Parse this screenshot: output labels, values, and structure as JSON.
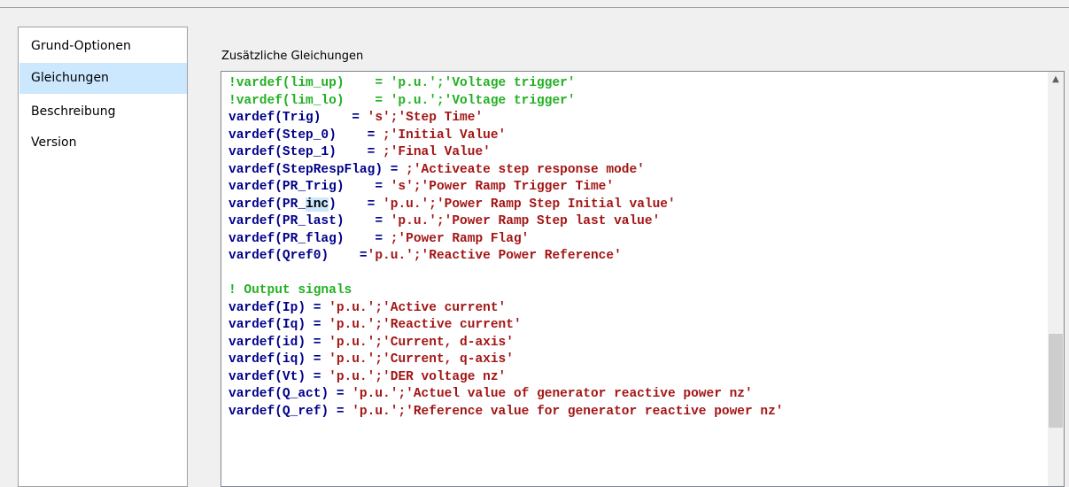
{
  "sidebar": {
    "items": [
      {
        "label": "Grund-Optionen"
      },
      {
        "label": "Gleichungen"
      },
      {
        "label": "Beschreibung"
      },
      {
        "label": "Version"
      }
    ],
    "selected": "Gleichungen"
  },
  "section_label": "Zusätzliche Gleichungen",
  "code_lines": [
    [
      [
        "cm",
        "!vardef(lim_up)    = 'p.u.';'Voltage trigger'"
      ]
    ],
    [
      [
        "cm",
        "!vardef(lim_lo)    = 'p.u.';'Voltage trigger'"
      ]
    ],
    [
      [
        "kw",
        "vardef(Trig)    = "
      ],
      [
        "str",
        "'s';'Step Time'"
      ]
    ],
    [
      [
        "kw",
        "vardef(Step_0)    = "
      ],
      [
        "str",
        ";'Initial Value'"
      ]
    ],
    [
      [
        "kw",
        "vardef(Step_1)    = "
      ],
      [
        "str",
        ";'Final Value'"
      ]
    ],
    [
      [
        "kw",
        "vardef(StepRespFlag) = "
      ],
      [
        "str",
        ";'Activeate step response mode'"
      ]
    ],
    [
      [
        "kw",
        "vardef(PR_Trig)    = "
      ],
      [
        "str",
        "'s';'Power Ramp Trigger Time'"
      ]
    ],
    [
      [
        "kw",
        "vardef(PR_"
      ],
      [
        "sel",
        "inc"
      ],
      [
        "kw",
        ")    = "
      ],
      [
        "str",
        "'p.u.';'Power Ramp Step Initial value'"
      ]
    ],
    [
      [
        "kw",
        "vardef(PR_last)    = "
      ],
      [
        "str",
        "'p.u.';'Power Ramp Step last value'"
      ]
    ],
    [
      [
        "kw",
        "vardef(PR_flag)    = "
      ],
      [
        "str",
        ";'Power Ramp Flag'"
      ]
    ],
    [
      [
        "kw",
        "vardef(Qref0)    ="
      ],
      [
        "str",
        "'p.u.';'Reactive Power Reference'"
      ]
    ],
    [
      [
        "kw",
        ""
      ]
    ],
    [
      [
        "cm",
        "! Output signals"
      ]
    ],
    [
      [
        "kw",
        "vardef(Ip) = "
      ],
      [
        "str",
        "'p.u.';'Active current'"
      ]
    ],
    [
      [
        "kw",
        "vardef(Iq) = "
      ],
      [
        "str",
        "'p.u.';'Reactive current'"
      ]
    ],
    [
      [
        "kw",
        "vardef(id) = "
      ],
      [
        "str",
        "'p.u.';'Current, d-axis'"
      ]
    ],
    [
      [
        "kw",
        "vardef(iq) = "
      ],
      [
        "str",
        "'p.u.';'Current, q-axis'"
      ]
    ],
    [
      [
        "kw",
        "vardef(Vt) = "
      ],
      [
        "str",
        "'p.u.';'DER voltage nz'"
      ]
    ],
    [
      [
        "kw",
        "vardef(Q_act) = "
      ],
      [
        "str",
        "'p.u.';'Actuel value of generator reactive power nz'"
      ]
    ],
    [
      [
        "kw",
        "vardef(Q_ref) = "
      ],
      [
        "str",
        "'p.u.';'Reference value for generator reactive power nz'"
      ]
    ]
  ],
  "colors": {
    "keyword": "#00008b",
    "string": "#a31515",
    "comment": "#22b022",
    "selection": "#cce8ff"
  },
  "scrollbar": {
    "position_fraction": 0.63
  }
}
